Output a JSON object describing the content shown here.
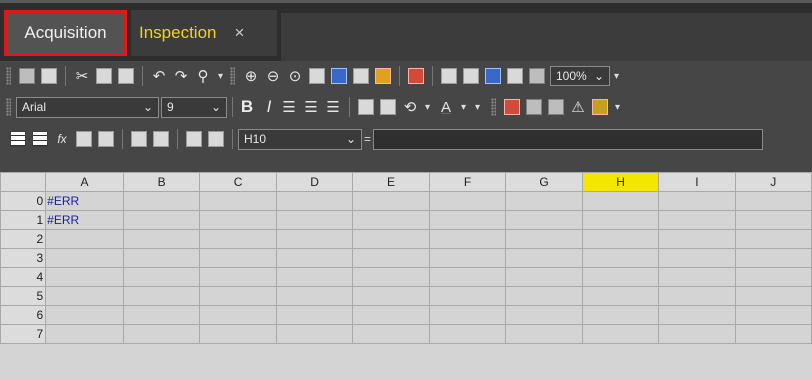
{
  "tabs": [
    {
      "label": "Acquisition",
      "active": true
    },
    {
      "label": "Inspection",
      "close": "×"
    }
  ],
  "toolbar": {
    "zoom": "100%",
    "font_name": "Arial",
    "font_size": "9",
    "bold": "B",
    "italic": "I",
    "cell_ref": "H10",
    "formula_equals": "="
  },
  "sheet": {
    "columns": [
      "A",
      "B",
      "C",
      "D",
      "E",
      "F",
      "G",
      "H",
      "I",
      "J"
    ],
    "selected_column": "H",
    "rows": [
      {
        "num": "0",
        "A": "#ERR"
      },
      {
        "num": "1",
        "A": "#ERR"
      },
      {
        "num": "2",
        "A": ""
      },
      {
        "num": "3",
        "A": ""
      },
      {
        "num": "4",
        "A": ""
      },
      {
        "num": "5",
        "A": ""
      },
      {
        "num": "6",
        "A": ""
      },
      {
        "num": "7",
        "A": ""
      }
    ]
  },
  "colors": {
    "selected_column": "#f4e600",
    "active_tab_outline": "#e01818",
    "inspection_tab_text": "#f2d21b"
  }
}
